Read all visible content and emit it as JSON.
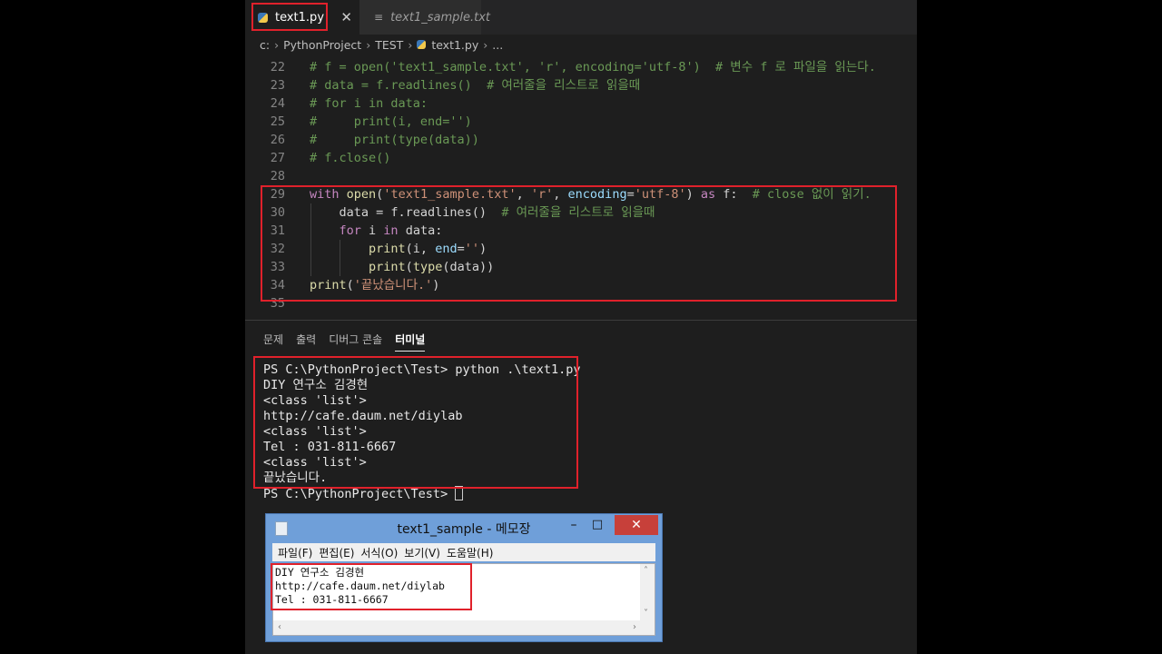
{
  "tabs": [
    {
      "label": "text1.py",
      "active": true,
      "close": "✕"
    },
    {
      "label": "text1_sample.txt",
      "active": false
    }
  ],
  "breadcrumb": [
    "c:",
    "PythonProject",
    "TEST",
    "text1.py",
    "..."
  ],
  "editor": {
    "lines": [
      {
        "n": "22",
        "text": "# f = open('text1_sample.txt', 'r', encoding='utf-8')  # 변수 f 로 파일을 읽는다."
      },
      {
        "n": "23",
        "text": "# data = f.readlines()  # 여러줄을 리스트로 읽을때"
      },
      {
        "n": "24",
        "text": "# for i in data:"
      },
      {
        "n": "25",
        "text": "#     print(i, end='')"
      },
      {
        "n": "26",
        "text": "#     print(type(data))"
      },
      {
        "n": "27",
        "text": "# f.close()"
      },
      {
        "n": "28",
        "text": ""
      },
      {
        "n": "29",
        "text": "with open('text1_sample.txt', 'r', encoding='utf-8') as f:  # close 없이 읽기."
      },
      {
        "n": "30",
        "text": "    data = f.readlines()  # 여러줄을 리스트로 읽을때"
      },
      {
        "n": "31",
        "text": "    for i in data:"
      },
      {
        "n": "32",
        "text": "        print(i, end='')"
      },
      {
        "n": "33",
        "text": "        print(type(data))"
      },
      {
        "n": "34",
        "text": "print('끝났습니다.')"
      },
      {
        "n": "35",
        "text": ""
      }
    ]
  },
  "panel": {
    "tabs": [
      "문제",
      "출력",
      "디버그 콘솔",
      "터미널"
    ],
    "active_tab": "터미널",
    "terminal": [
      "PS C:\\PythonProject\\Test> python .\\text1.py",
      "DIY 연구소 김경현",
      "<class 'list'>",
      "http://cafe.daum.net/diylab",
      "<class 'list'>",
      "Tel : 031-811-6667",
      "<class 'list'>",
      "끝났습니다."
    ],
    "prompt": "PS C:\\PythonProject\\Test> "
  },
  "notepad": {
    "title": "text1_sample - 메모장",
    "minimize": "–",
    "maximize": "□",
    "close": "✕",
    "menu": [
      "파일(F)",
      "편집(E)",
      "서식(O)",
      "보기(V)",
      "도움말(H)"
    ],
    "content": [
      "DIY 연구소 김경현",
      "http://cafe.daum.net/diylab",
      "Tel : 031-811-6667"
    ]
  },
  "colors": {
    "highlight_box": "#e0212b",
    "comment": "#6a9955",
    "keyword": "#c586c0",
    "string": "#ce9178",
    "builtin": "#dcdcaa",
    "editor_bg": "#1e1e1e"
  }
}
